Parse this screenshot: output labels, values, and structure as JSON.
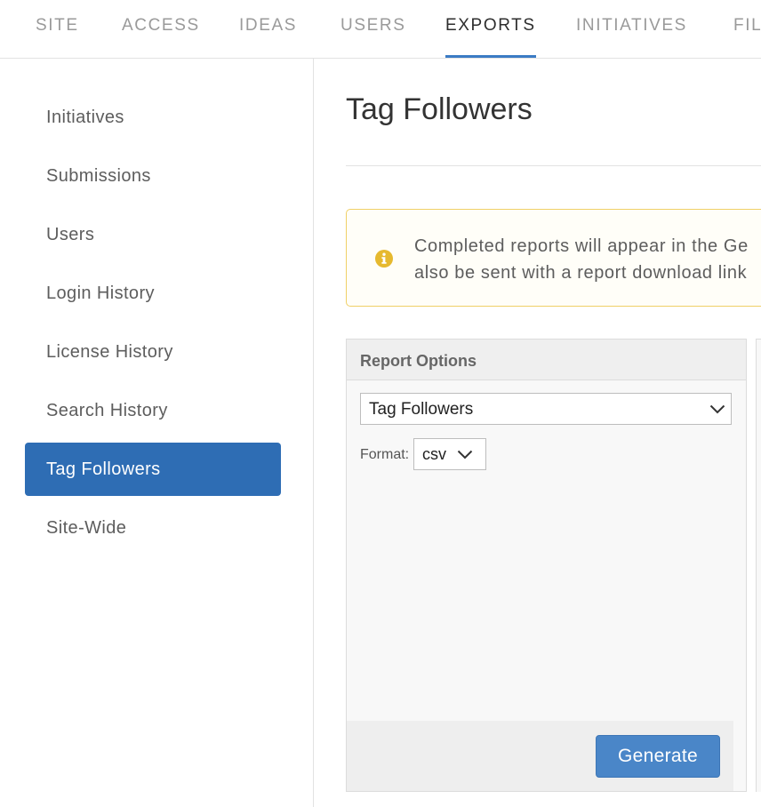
{
  "top_tabs": [
    {
      "label": "SITE"
    },
    {
      "label": "ACCESS"
    },
    {
      "label": "IDEAS"
    },
    {
      "label": "USERS"
    },
    {
      "label": "EXPORTS",
      "active": true
    },
    {
      "label": "INITIATIVES"
    },
    {
      "label": "FIL"
    }
  ],
  "sidebar": {
    "items": [
      {
        "label": "Initiatives"
      },
      {
        "label": "Submissions"
      },
      {
        "label": "Users"
      },
      {
        "label": "Login History"
      },
      {
        "label": "License History"
      },
      {
        "label": "Search History"
      },
      {
        "label": "Tag Followers",
        "active": true
      },
      {
        "label": "Site-Wide"
      }
    ]
  },
  "main": {
    "title": "Tag Followers",
    "notice": {
      "icon": "info-circle-icon",
      "line1": "Completed reports will appear in the Ge",
      "line2": "also be sent with a report download link"
    },
    "report_options": {
      "header": "Report Options",
      "report_type": "Tag Followers",
      "format_label": "Format:",
      "format_value": "csv",
      "generate_label": "Generate"
    }
  },
  "colors": {
    "accent": "#2e6db4",
    "button": "#4a86c8",
    "notice_border": "#f0d067",
    "notice_icon": "#e6b92f"
  }
}
